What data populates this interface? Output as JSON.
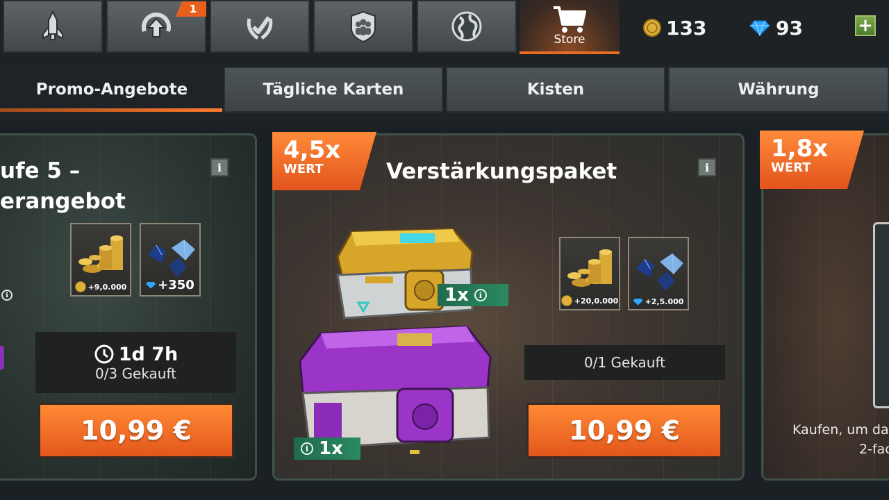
{
  "nav": {
    "items": [
      {
        "icon": "rocket-icon"
      },
      {
        "icon": "upgrade-arrow-icon",
        "badge": "1"
      },
      {
        "icon": "laurel-check-icon"
      },
      {
        "icon": "clan-shield-icon"
      },
      {
        "icon": "globe-icon"
      }
    ],
    "store_label": "Store",
    "coins": "133",
    "gems": "93",
    "add_label": "+"
  },
  "tabs": [
    "Promo-Angebote",
    "Tägliche Karten",
    "Kisten",
    "Währung"
  ],
  "cards": {
    "left": {
      "title_line1": "ufe 5 –",
      "title_line2": "erangebot",
      "info": "i",
      "reward_coins": "+9,0.000",
      "reward_gems": "+350",
      "timer": "1d 7h",
      "bought": "0/3  Gekauft",
      "price": "10,99 €"
    },
    "middle": {
      "wert_multiplier": "4,5x",
      "wert_label": "WERT",
      "title": "Verstärkungspaket",
      "info": "i",
      "gold_crate_qty": "1x",
      "purple_crate_qty": "1x",
      "reward_coins": "+20,0.000",
      "reward_gems": "+2,5.000",
      "bought": "0/1  Gekauft",
      "price": "10,99 €"
    },
    "right": {
      "wert_multiplier": "1,8x",
      "wert_label": "WERT",
      "note_line1": "Kaufen, um da",
      "note_line2": "2-fac"
    }
  },
  "colors": {
    "accent_orange": "#f07a2c",
    "tab_bg": "#464d51",
    "qty_green": "#2b8a60"
  }
}
